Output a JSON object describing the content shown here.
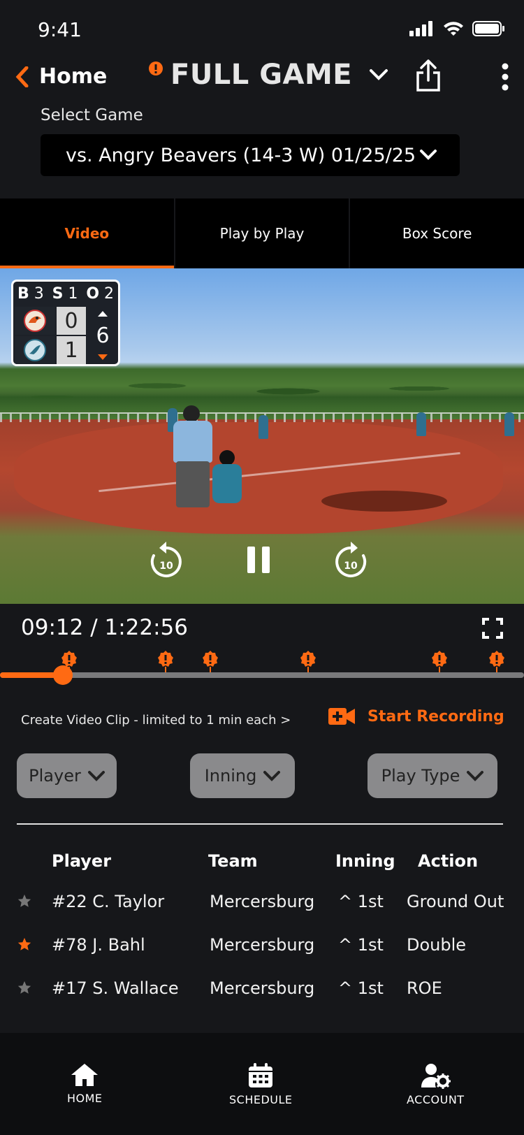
{
  "status_bar": {
    "time": "9:41"
  },
  "header": {
    "back_label": "Home",
    "title": "FULL GAME",
    "select_label": "Select Game",
    "selected_game": "vs. Angry Beavers (14-3 W) 01/25/25"
  },
  "tabs": [
    {
      "label": "Video",
      "active": true
    },
    {
      "label": "Play by Play",
      "active": false
    },
    {
      "label": "Box Score",
      "active": false
    }
  ],
  "scoreboard": {
    "balls_label": "B",
    "balls": "3",
    "strikes_label": "S",
    "strikes": "1",
    "outs_label": "O",
    "outs": "2",
    "away_score": "0",
    "home_score": "1",
    "inning": "6"
  },
  "video": {
    "rewind_seconds": "10",
    "forward_seconds": "10",
    "timecode": "09:12 / 1:22:56",
    "progress_fraction": 0.112
  },
  "clip": {
    "text": "Create Video Clip - limited to 1 min each >",
    "record_label": "Start Recording"
  },
  "filters": {
    "player": "Player",
    "inning": "Inning",
    "play_type": "Play Type"
  },
  "table": {
    "headers": [
      "Player",
      "Team",
      "Inning",
      "Action"
    ],
    "rows": [
      {
        "player": "#22 C. Taylor",
        "team": "Mercersburg",
        "inning": "^ 1st",
        "action": "Ground Out",
        "starred": false
      },
      {
        "player": "#78 J. Bahl",
        "team": "Mercersburg",
        "inning": "^ 1st",
        "action": "Double",
        "starred": true
      },
      {
        "player": "#17 S. Wallace",
        "team": "Mercersburg",
        "inning": "^ 1st",
        "action": "ROE",
        "starred": false
      }
    ]
  },
  "nav": {
    "home": "HOME",
    "schedule": "SCHEDULE",
    "account": "ACCOUNT"
  },
  "colors": {
    "accent": "#ff6a13",
    "background": "#16171a"
  }
}
